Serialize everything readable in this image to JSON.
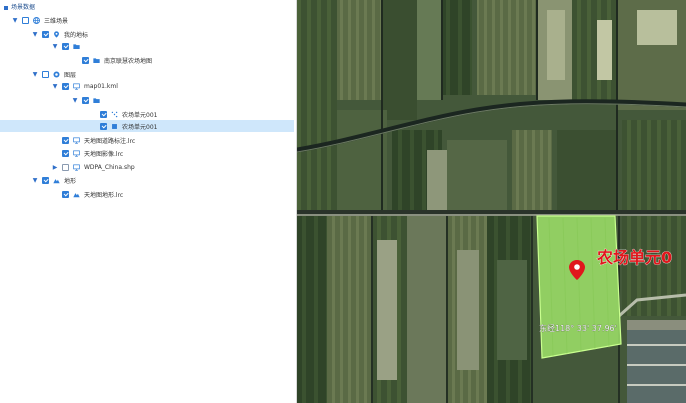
{
  "panel": {
    "title": "场景数据",
    "tree": [
      {
        "label": "三维场景",
        "level": 0,
        "expander": "open",
        "check": "box",
        "icon": "globe-icon"
      },
      {
        "label": "我的地标",
        "level": 1,
        "expander": "open",
        "check": "on",
        "icon": "pin-icon"
      },
      {
        "label": "",
        "level": 2,
        "expander": "open",
        "check": "on",
        "icon": "folder-icon"
      },
      {
        "label": "南京联慧农场地图",
        "level": 3,
        "expander": "none",
        "check": "on",
        "icon": "folder-icon"
      },
      {
        "label": "图层",
        "level": 1,
        "expander": "open",
        "check": "box",
        "icon": "layers-icon"
      },
      {
        "label": "map01.kml",
        "level": 2,
        "expander": "open",
        "check": "on",
        "icon": "monitor-icon"
      },
      {
        "label": "",
        "level": 3,
        "expander": "open",
        "check": "on",
        "icon": "folder-icon"
      },
      {
        "label": "农场单元001",
        "level": 4,
        "expander": "none",
        "check": "on",
        "icon": "dots-icon"
      },
      {
        "label": "农场单元001",
        "level": 4,
        "expander": "none",
        "check": "on",
        "icon": "square-icon",
        "selected": true
      },
      {
        "label": "天地图道路标注.lrc",
        "level": 2,
        "expander": "none",
        "check": "on",
        "icon": "monitor-icon"
      },
      {
        "label": "天地图影像.lrc",
        "level": 2,
        "expander": "none",
        "check": "on",
        "icon": "monitor-icon"
      },
      {
        "label": "WDPA_China.shp",
        "level": 2,
        "expander": "closed",
        "check": "off",
        "icon": "monitor-icon"
      },
      {
        "label": "地形",
        "level": 1,
        "expander": "open",
        "check": "on",
        "icon": "terrain-icon"
      },
      {
        "label": "天地图地形.lrc",
        "level": 2,
        "expander": "none",
        "check": "on",
        "icon": "terrain-icon"
      }
    ]
  },
  "map": {
    "farm_label": "农场单元0",
    "coordinate_readout": "东经118° 33'  37.96'",
    "colors": {
      "polygon_fill": "#9fe36a",
      "polygon_stroke": "#c9ff8f",
      "label": "#e0171c",
      "marker": "#e0171c"
    }
  }
}
